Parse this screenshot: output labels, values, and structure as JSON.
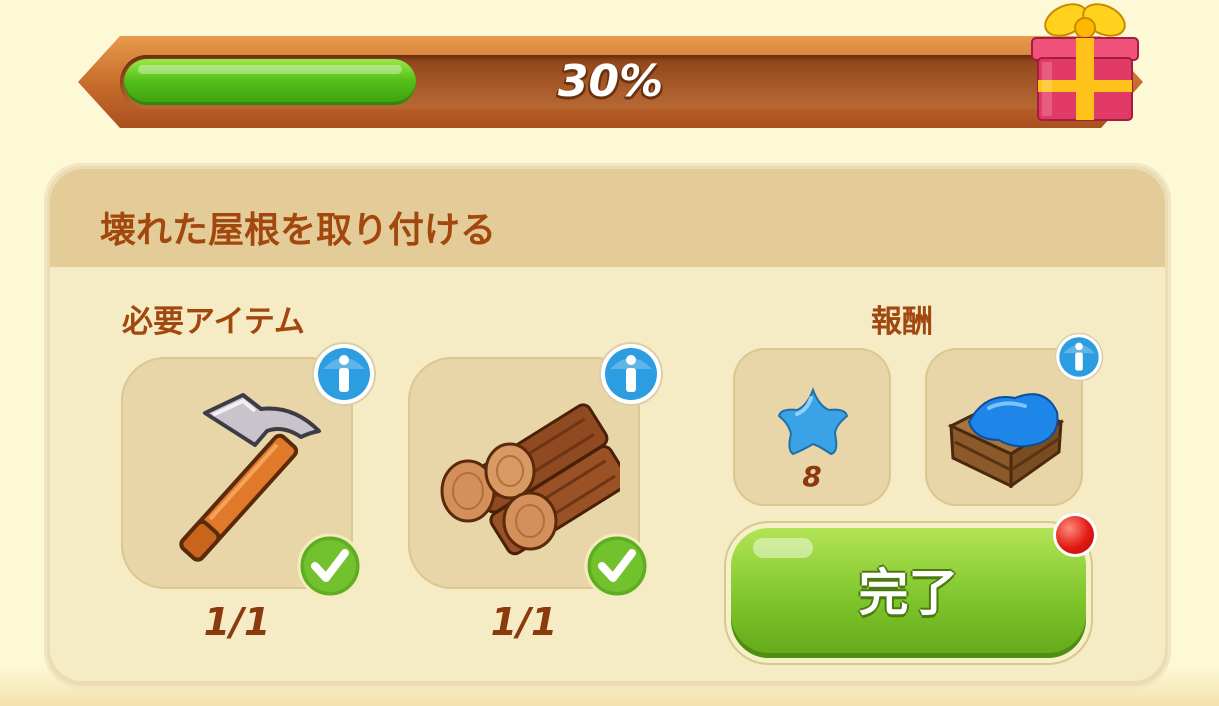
{
  "progress": {
    "label": "30%",
    "value": 0.3
  },
  "quest": {
    "title": "壊れた屋根を取り付ける"
  },
  "required": {
    "label": "必要アイテム",
    "items": [
      {
        "name": "hammer",
        "count": "1/1",
        "complete": true
      },
      {
        "name": "logs",
        "count": "1/1",
        "complete": true
      }
    ]
  },
  "reward": {
    "label": "報酬",
    "items": [
      {
        "name": "blue-star",
        "count": "8"
      },
      {
        "name": "crate-blue-cloth"
      }
    ]
  },
  "complete_button": {
    "label": "完了"
  },
  "colors": {
    "accent_brown": "#a2480f",
    "button_green": "#7fc52c",
    "progress_green": "#55c21a"
  }
}
